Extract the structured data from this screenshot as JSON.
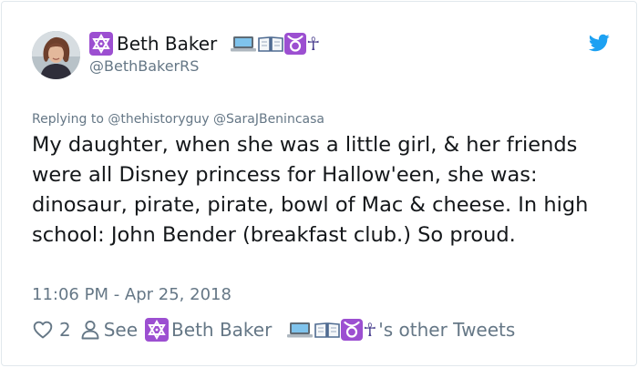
{
  "profile": {
    "display_name": "Beth Baker",
    "handle": "@BethBakerRS",
    "name_emojis": [
      "laptop-emoji",
      "open-book-emoji",
      "taurus-emoji",
      "ankh-emoji"
    ]
  },
  "tweet": {
    "reply_prefix": "Replying to",
    "reply_to": [
      "@thehistoryguy",
      "@SaraJBenincasa"
    ],
    "text": "My daughter, when she was a little girl, & her friends were all Disney princess for Hallow'een, she was: dinosaur, pirate, pirate, bowl of Mac & cheese. In high school: John Bender (breakfast club.) So proud.",
    "timestamp": "11:06 PM - Apr 25, 2018"
  },
  "actions": {
    "likes": "2",
    "see_label": "See",
    "author_name": "Beth Baker",
    "other_tweets_suffix": "'s other Tweets"
  },
  "icons": {
    "like": "heart-icon",
    "person": "person-icon",
    "brand": "twitter-bird-icon",
    "badge": "star-of-david-icon",
    "ankh_glyph": "☥"
  },
  "colors": {
    "text": "#14171a",
    "secondary": "#657786",
    "twitter_blue": "#1da1f2",
    "badge_purple": "#9c4fd1",
    "border": "#e1e8ed"
  }
}
